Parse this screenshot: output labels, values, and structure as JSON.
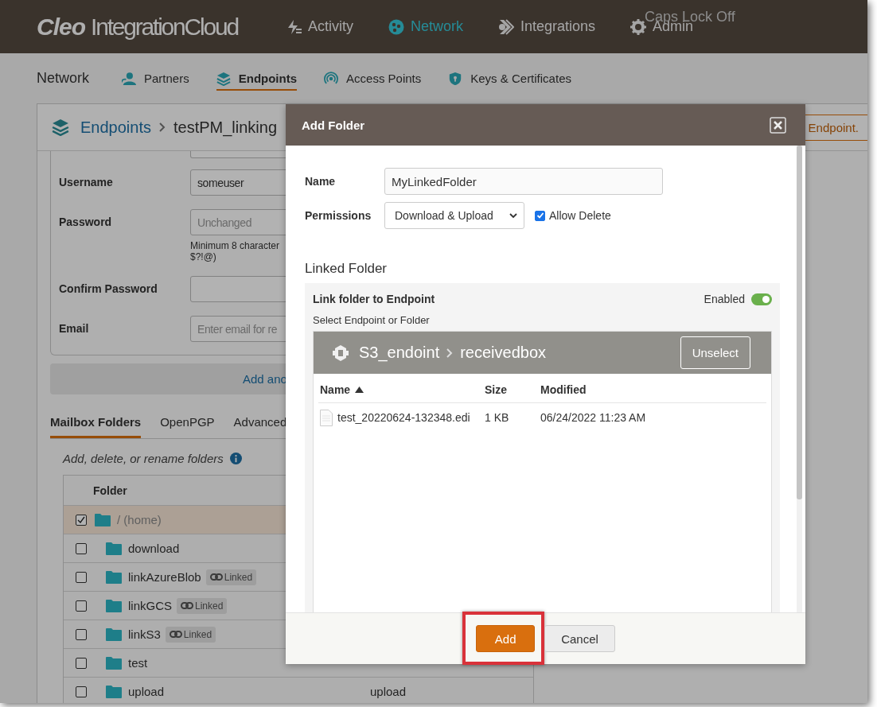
{
  "top_bar": {
    "logo_bold": "Cleo",
    "logo_rest": "IntegrationCloud",
    "nav": [
      {
        "label": "Activity",
        "selected": false
      },
      {
        "label": "Network",
        "selected": true
      },
      {
        "label": "Integrations",
        "selected": false
      },
      {
        "label": "Admin",
        "selected": false
      }
    ],
    "caps_lock_note": "Caps Lock Off"
  },
  "sub_nav": {
    "title": "Network",
    "tabs": [
      {
        "label": "Partners",
        "selected": false
      },
      {
        "label": "Endpoints",
        "selected": true
      },
      {
        "label": "Access Points",
        "selected": false
      },
      {
        "label": "Keys & Certificates",
        "selected": false
      }
    ]
  },
  "card": {
    "breadcrumb": [
      "Endpoints",
      "testPM_linking"
    ],
    "header_button": "Endpoint.",
    "form": [
      {
        "label": "Username",
        "value": "someuser"
      },
      {
        "label": "Password",
        "placeholder": "Unchanged",
        "hint_lines": [
          "Minimum 8 character",
          "$?!@)"
        ]
      },
      {
        "label": "Confirm Password"
      },
      {
        "label": "Email",
        "placeholder": "Enter email for re"
      }
    ],
    "add_link": "Add ano",
    "tabs": [
      {
        "label": "Mailbox Folders",
        "selected": true
      },
      {
        "label": "OpenPGP",
        "selected": false
      },
      {
        "label": "Advanced",
        "selected": false
      }
    ],
    "folders_note": "Add, delete, or rename folders",
    "folder_table": {
      "columns": [
        "Folder"
      ],
      "rows": [
        {
          "name": "/ (home)",
          "checked": true,
          "selected": true,
          "children": [
            {
              "name": "download",
              "checked": false,
              "selected": false
            },
            {
              "name": "linkAzureBlob",
              "checked": false,
              "selected": false,
              "tag": "Linked"
            },
            {
              "name": "linkGCS",
              "checked": false,
              "selected": false,
              "tag": "Linked"
            },
            {
              "name": "linkS3",
              "checked": false,
              "selected": false,
              "tag": "Linked"
            },
            {
              "name": "test",
              "checked": false,
              "selected": false
            },
            {
              "name": "upload",
              "checked": false,
              "selected": false,
              "column_2": "upload"
            }
          ]
        }
      ]
    }
  },
  "modal": {
    "title": "Add Folder",
    "name_label": "Name",
    "name_value": "MyLinkedFolder",
    "permissions_label": "Permissions",
    "permissions_value": "Download & Upload",
    "allow_delete": {
      "label": "Allow Delete",
      "checked": true
    },
    "section_title": "Linked Folder",
    "link_panel": {
      "title": "Link folder to Endpoint",
      "toggle_label": "Enabled",
      "on": true,
      "hint": "Select Endpoint or Folder",
      "browser": {
        "path": [
          "S3_endoint",
          "receivedbox"
        ],
        "unselect": "Unselect",
        "columns": [
          {
            "label": "Name",
            "sorted": true
          },
          {
            "label": "Size",
            "sorted": false
          },
          {
            "label": "Modified",
            "sorted": false
          }
        ],
        "rows": [
          {
            "cells": [
              "test_20220624-132348.edi",
              "1 KB",
              "06/24/2022 11:23 AM"
            ]
          }
        ]
      }
    },
    "buttons": [
      {
        "label": "Add",
        "kind": "primary",
        "highlighted": true
      },
      {
        "label": "Cancel",
        "kind": "secondary",
        "highlighted": false
      }
    ]
  }
}
